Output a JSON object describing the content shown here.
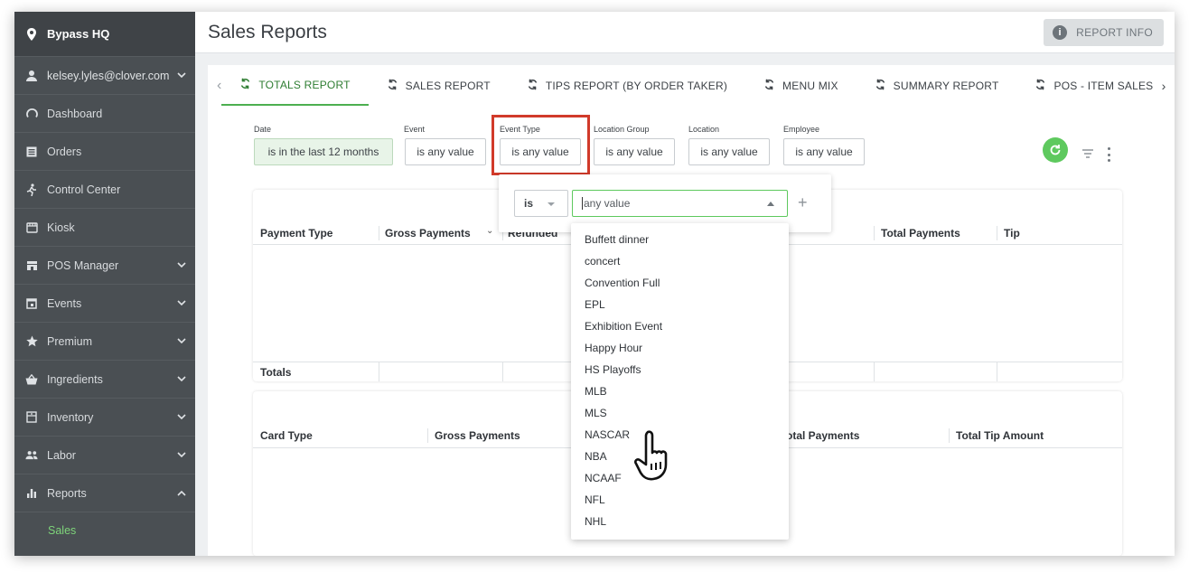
{
  "sidebar": {
    "location": "Bypass HQ",
    "user": "kelsey.lyles@clover.com",
    "items": [
      {
        "label": "Dashboard",
        "icon": "dashboard-icon",
        "chevron": ""
      },
      {
        "label": "Orders",
        "icon": "orders-icon",
        "chevron": ""
      },
      {
        "label": "Control Center",
        "icon": "runner-icon",
        "chevron": ""
      },
      {
        "label": "Kiosk",
        "icon": "kiosk-icon",
        "chevron": ""
      },
      {
        "label": "POS Manager",
        "icon": "pos-icon",
        "chevron": "down"
      },
      {
        "label": "Events",
        "icon": "calendar-icon",
        "chevron": "down"
      },
      {
        "label": "Premium",
        "icon": "star-icon",
        "chevron": "down"
      },
      {
        "label": "Ingredients",
        "icon": "basket-icon",
        "chevron": "down"
      },
      {
        "label": "Inventory",
        "icon": "inventory-icon",
        "chevron": "down"
      },
      {
        "label": "Labor",
        "icon": "people-icon",
        "chevron": "down"
      },
      {
        "label": "Reports",
        "icon": "bar-chart-icon",
        "chevron": "up"
      }
    ],
    "subitem": "Sales"
  },
  "header": {
    "title": "Sales Reports",
    "report_info": "REPORT INFO"
  },
  "tabs": [
    {
      "label": "TOTALS REPORT",
      "active": true
    },
    {
      "label": "SALES REPORT",
      "active": false
    },
    {
      "label": "TIPS REPORT (BY ORDER TAKER)",
      "active": false
    },
    {
      "label": "MENU MIX",
      "active": false
    },
    {
      "label": "SUMMARY REPORT",
      "active": false
    },
    {
      "label": "POS - ITEM SALES BY L",
      "active": false
    }
  ],
  "filters": {
    "date": {
      "label": "Date",
      "value": "is in the last 12 months"
    },
    "event": {
      "label": "Event",
      "value": "is any value"
    },
    "event_type": {
      "label": "Event Type",
      "value": "is any value"
    },
    "location_group": {
      "label": "Location Group",
      "value": "is any value"
    },
    "location": {
      "label": "Location",
      "value": "is any value"
    },
    "employee": {
      "label": "Employee",
      "value": "is any value"
    }
  },
  "table1": {
    "headers": [
      "Payment Type",
      "Gross Payments",
      "Refunded",
      "Total Payments",
      "Tip"
    ],
    "totals_label": "Totals"
  },
  "table2": {
    "headers": [
      "Card Type",
      "Gross Payments",
      "otal Payments",
      "Total Tip Amount"
    ]
  },
  "dropdown": {
    "operator": "is",
    "input_placeholder": "any value",
    "options": [
      "Buffett dinner",
      "concert",
      "Convention Full",
      "EPL",
      "Exhibition Event",
      "Happy Hour",
      "HS Playoffs",
      "MLB",
      "MLS",
      "NASCAR",
      "NBA",
      "NCAAF",
      "NFL",
      "NHL"
    ]
  },
  "colors": {
    "sidebar_bg": "#4a4f53",
    "accent_green": "#4caf50",
    "highlight_red": "#d13a2a"
  }
}
